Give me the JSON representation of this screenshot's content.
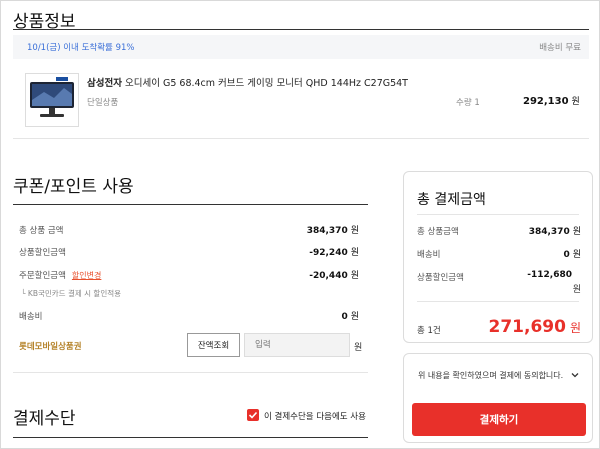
{
  "product_section": {
    "title": "상품정보",
    "delivery_estimate": "10/1(금) 이내 도착확률 91%",
    "delivery_fee": "배송비 무료",
    "product": {
      "brand": "삼성전자",
      "name": "오디세이 G5 68.4cm 커브드 게이밍 모니터 QHD 144Hz C27G54T",
      "option": "단일상품",
      "quantity": "수량 1",
      "price": "292,130",
      "unit": "원"
    }
  },
  "coupon_section": {
    "title": "쿠폰/포인트 사용",
    "rows": [
      {
        "label": "총 상품 금액",
        "value": "384,370",
        "unit": "원"
      },
      {
        "label": "상품할인금액",
        "value": "-92,240",
        "unit": "원"
      },
      {
        "label": "주문할인금액",
        "link": "할인변경",
        "value": "-20,440",
        "unit": "원"
      },
      {
        "label": "배송비",
        "value": "0",
        "unit": "원"
      }
    ],
    "discount_note": "└ KB국민카드 결제 시 할인적용",
    "mobile_voucher": {
      "label": "롯데모바일상품권",
      "balance_button": "잔액조회",
      "input_placeholder": "입력",
      "unit": "원"
    }
  },
  "payment_section": {
    "title": "결제수단",
    "remember_label": "이 결제수단을 다음에도 사용",
    "remember_checked": true
  },
  "summary": {
    "title": "총 결제금액",
    "rows": [
      {
        "label": "총 상품금액",
        "value": "384,370",
        "unit": "원"
      },
      {
        "label": "배송비",
        "value": "0",
        "unit": "원"
      },
      {
        "label": "상품할인금액",
        "value": "-112,680",
        "unit": "원"
      }
    ],
    "total_count": "총 1건",
    "total_price": "271,690",
    "unit": "원"
  },
  "agreement": {
    "text": "위 내용을 확인하였으며 결제에 동의합니다.",
    "pay_button": "결제하기"
  },
  "colors": {
    "accent": "#e8302a",
    "link_blue": "#3a6fd8",
    "voucher_gold": "#b5832a"
  }
}
